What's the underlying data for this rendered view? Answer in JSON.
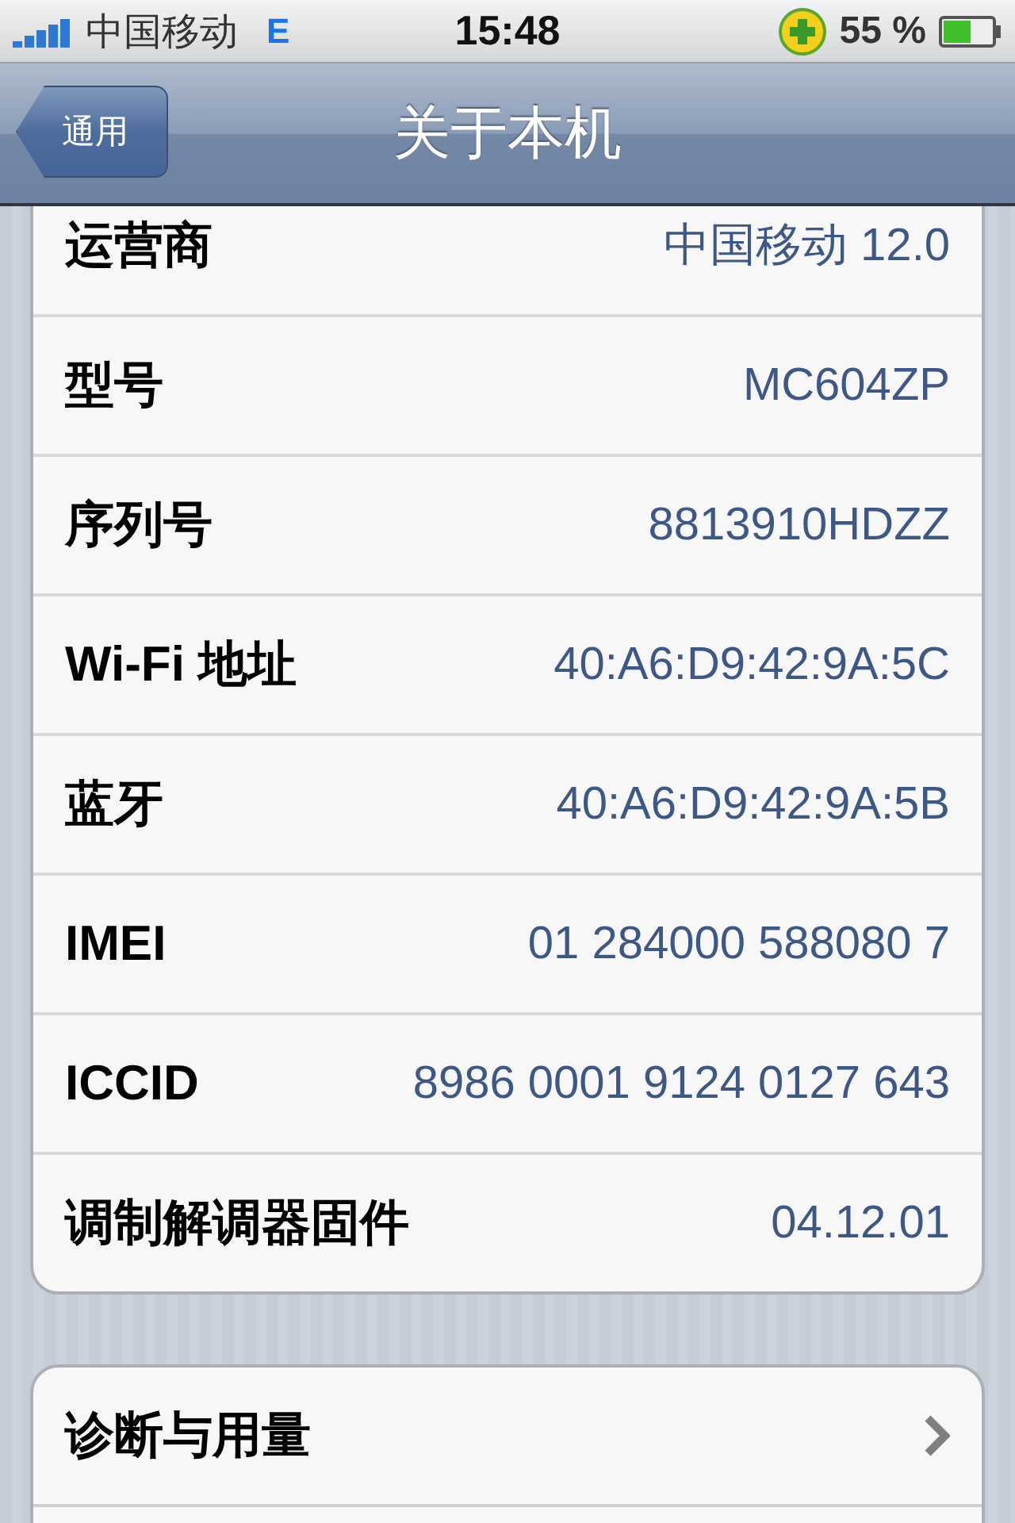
{
  "status_bar": {
    "carrier": "中国移动",
    "network": "E",
    "time": "15:48",
    "battery_text": "55 %"
  },
  "nav_bar": {
    "back": "通用",
    "title": "关于本机"
  },
  "groups": [
    {
      "rows": [
        {
          "label": "运营商",
          "value": "中国移动 12.0"
        },
        {
          "label": "型号",
          "value": "MC604ZP"
        },
        {
          "label": "序列号",
          "value": "8813910HDZZ"
        },
        {
          "label": "Wi-Fi 地址",
          "value": "40:A6:D9:42:9A:5C"
        },
        {
          "label": "蓝牙",
          "value": "40:A6:D9:42:9A:5B"
        },
        {
          "label": "IMEI",
          "value": "01 284000 588080 7"
        },
        {
          "label": "ICCID",
          "value": "8986 0001 9124 0127 643"
        },
        {
          "label": "调制解调器固件",
          "value": "04.12.01"
        }
      ]
    },
    {
      "rows": [
        {
          "label": "诊断与用量",
          "kind": "link"
        }
      ]
    }
  ]
}
